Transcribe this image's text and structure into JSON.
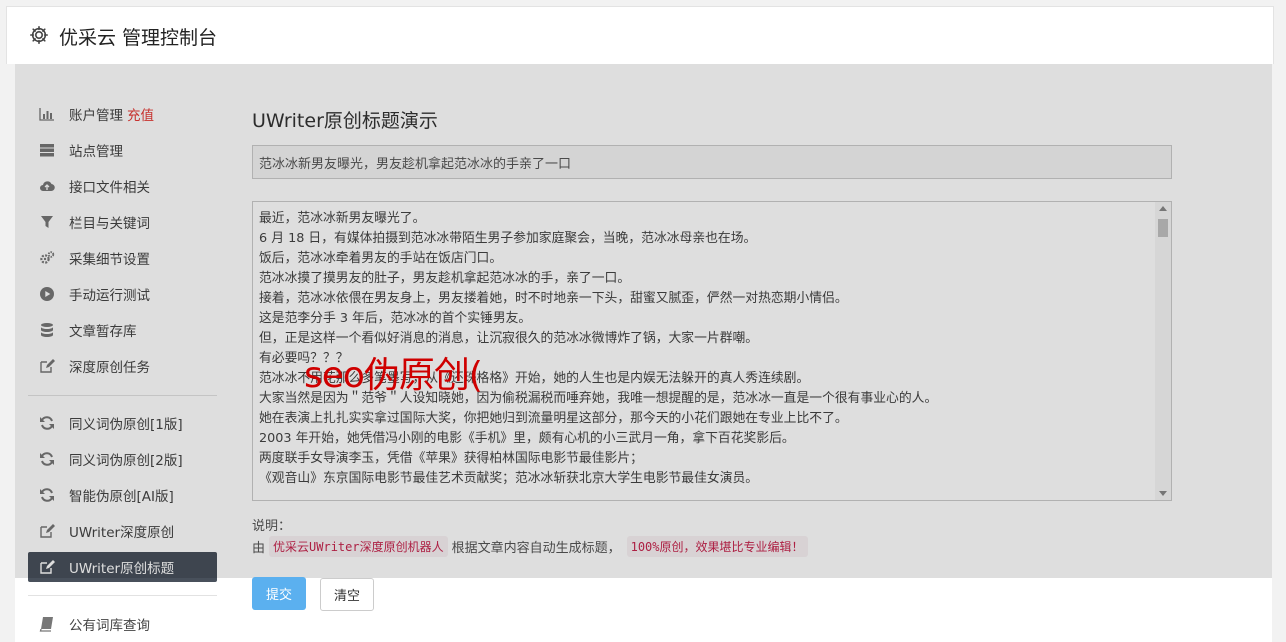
{
  "header": {
    "title": "优采云 管理控制台",
    "icon": "gear-icon"
  },
  "sidebar": {
    "groups": [
      [
        {
          "label": "账户管理",
          "extra": "充值",
          "icon": "bar-chart-icon"
        },
        {
          "label": "站点管理",
          "icon": "server-icon"
        },
        {
          "label": "接口文件相关",
          "icon": "cloud-upload-icon"
        },
        {
          "label": "栏目与关键词",
          "icon": "filter-icon"
        },
        {
          "label": "采集细节设置",
          "icon": "cogs-icon"
        },
        {
          "label": "手动运行测试",
          "icon": "play-circle-icon"
        },
        {
          "label": "文章暂存库",
          "icon": "database-icon"
        },
        {
          "label": "深度原创任务",
          "icon": "edit-icon"
        }
      ],
      [
        {
          "label": "同义词伪原创[1版]",
          "icon": "refresh-icon"
        },
        {
          "label": "同义词伪原创[2版]",
          "icon": "refresh-icon"
        },
        {
          "label": "智能伪原创[AI版]",
          "icon": "refresh-icon"
        },
        {
          "label": "UWriter深度原创",
          "icon": "edit-icon"
        },
        {
          "label": "UWriter原创标题",
          "icon": "edit-icon",
          "active": true
        }
      ],
      [
        {
          "label": "公有词库查询",
          "icon": "book-icon"
        }
      ]
    ]
  },
  "main": {
    "heading": "UWriter原创标题演示",
    "title_value": "范冰冰新男友曝光，男友趁机拿起范冰冰的手亲了一口",
    "article_lines": [
      "最近，范冰冰新男友曝光了。",
      "6 月 18 日，有媒体拍摄到范冰冰带陌生男子参加家庭聚会，当晚，范冰冰母亲也在场。",
      "饭后，范冰冰牵着男友的手站在饭店门口。",
      "范冰冰摸了摸男友的肚子，男友趁机拿起范冰冰的手，亲了一口。",
      "接着，范冰冰依偎在男友身上，男友搂着她，时不时地亲一下头，甜蜜又腻歪，俨然一对热恋期小情侣。",
      "这是范李分手 3 年后，范冰冰的首个实锤男友。",
      "但，正是这样一个看似好消息的消息，让沉寂很久的范冰冰微博炸了锅，大家一片群嘲。",
      "有必要吗？？？",
      "范冰冰不用花那么多笔墨写，从《还珠格格》开始，她的人生也是内娱无法躲开的真人秀连续剧。",
      "大家当然是因为＂范爷＂人设知晓她，因为偷税漏税而唾弃她，我唯一想提醒的是，范冰冰一直是一个很有事业心的人。",
      "她在表演上扎扎实实拿过国际大奖，你把她归到流量明星这部分，那今天的小花们跟她在专业上比不了。",
      "2003 年开始，她凭借冯小刚的电影《手机》里，颇有心机的小三武月一角，拿下百花奖影后。",
      "两度联手女导演李玉，凭借《苹果》获得柏林国际电影节最佳影片；",
      "《观音山》东京国际电影节最佳艺术贡献奖；范冰冰斩获北京大学生电影节最佳女演员。"
    ],
    "watermark": "seo伪原创(",
    "note_label": "说明：",
    "note_prefix": "由",
    "note_code1": "优采云UWriter深度原创机器人",
    "note_mid": "根据文章内容自动生成标题，",
    "note_code2": "100%原创，效果堪比专业编辑！",
    "submit_label": "提交",
    "clear_label": "清空"
  },
  "colors": {
    "accent": "#5bb0ef",
    "danger": "#e53935",
    "active_nav": "#48505b",
    "code": "#c7254e"
  }
}
